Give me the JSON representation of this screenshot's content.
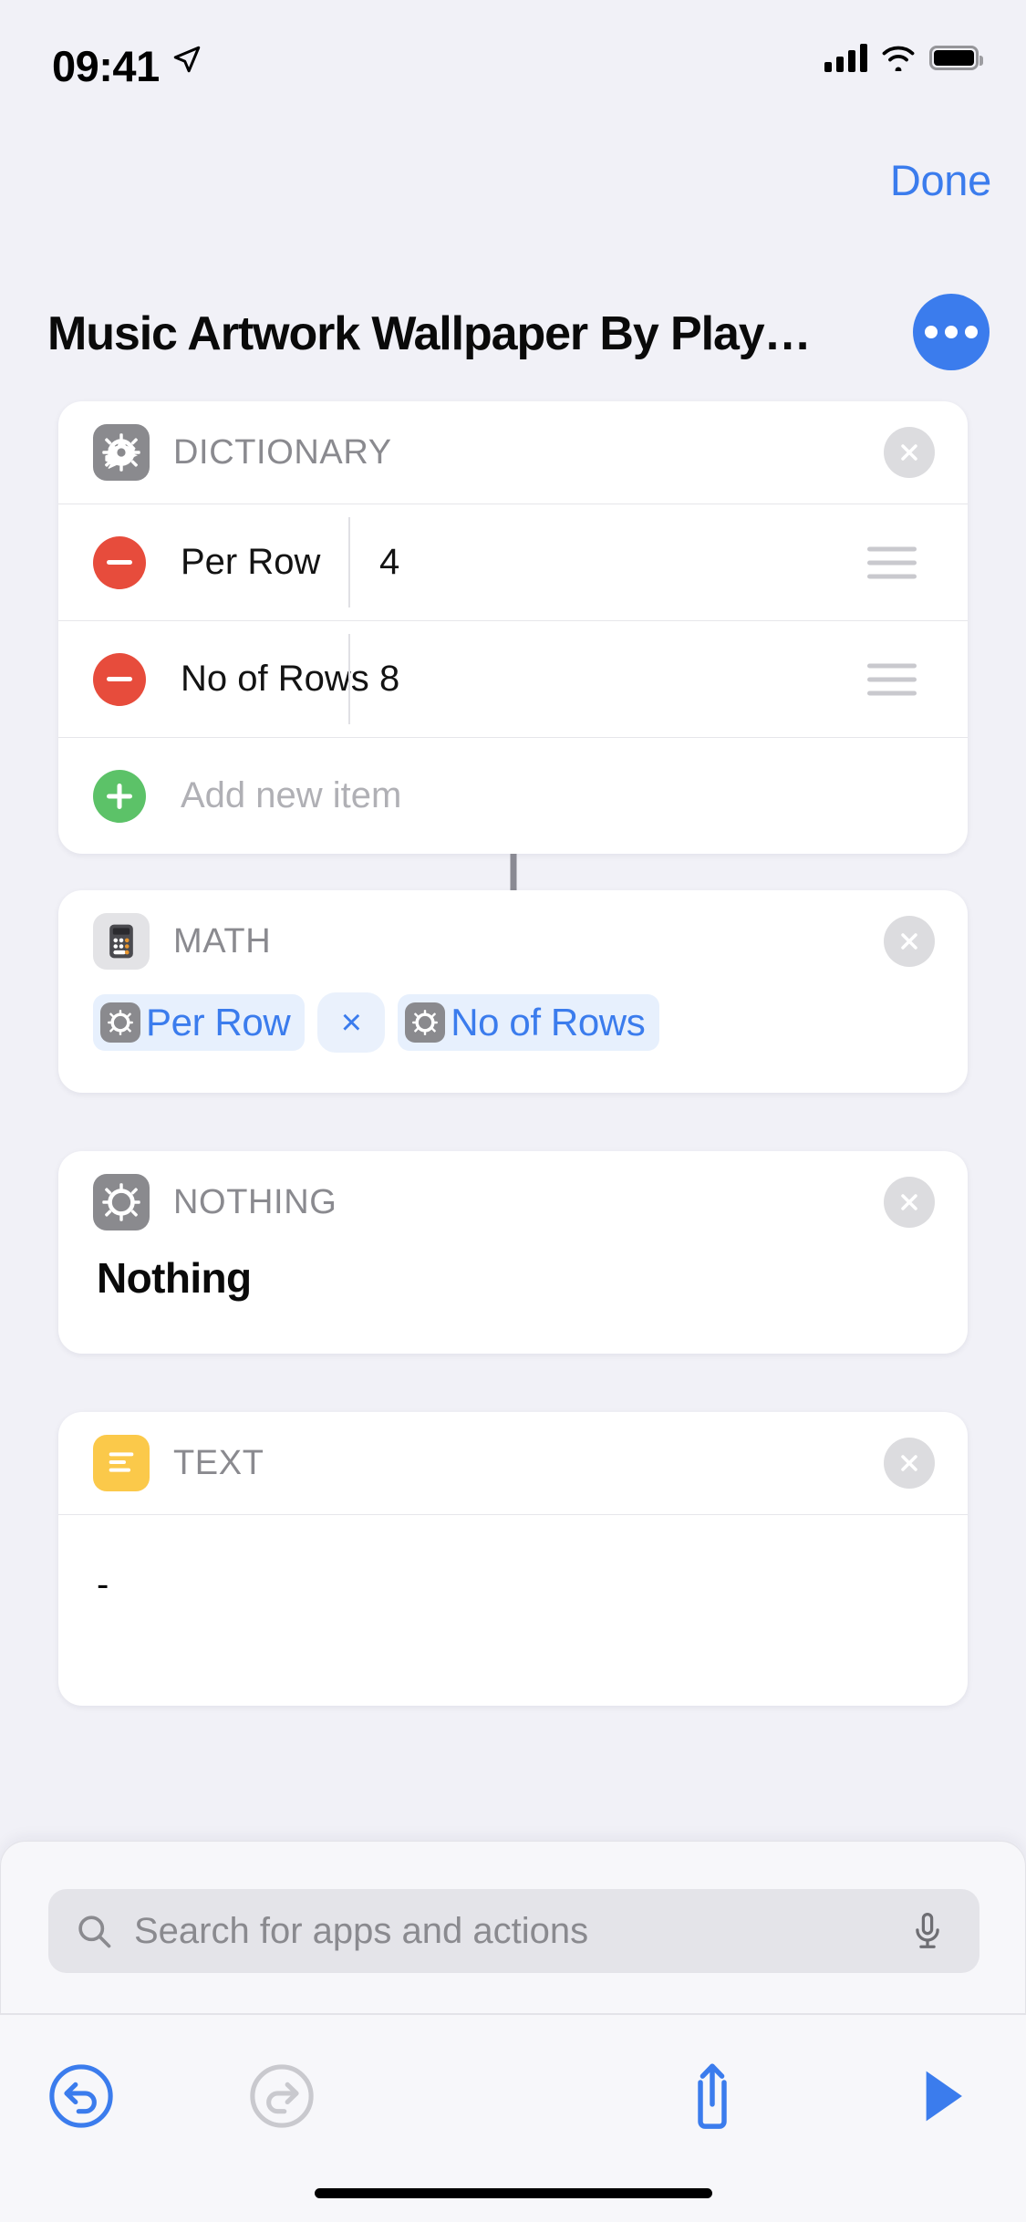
{
  "status_bar": {
    "time": "09:41",
    "location_icon": "location-arrow-icon",
    "cellular_icon": "cellular-bars-icon",
    "wifi_icon": "wifi-icon",
    "battery_icon": "battery-full-icon"
  },
  "nav": {
    "done_label": "Done",
    "accent_color": "#3b7ced"
  },
  "header": {
    "title": "Music Artwork Wallpaper By Play…",
    "more_button_icon": "ellipsis-icon",
    "more_button_color": "#3b7ced"
  },
  "actions": [
    {
      "kicker": "DICTIONARY",
      "icon": "gear-icon",
      "icon_color": "#8a8a8e",
      "close_icon": "close-circle-icon",
      "rows": [
        {
          "remove_icon": "minus-circle-icon",
          "key": "Per Row",
          "value": "4",
          "drag_icon": "drag-handle-icon"
        },
        {
          "remove_icon": "minus-circle-icon",
          "key": "No of Rows",
          "value": "8",
          "drag_icon": "drag-handle-icon"
        }
      ],
      "add_row": {
        "add_icon": "plus-circle-icon",
        "label": "Add new item"
      }
    },
    {
      "kicker": "MATH",
      "icon": "calculator-icon",
      "icon_color": "#e3e3e6",
      "close_icon": "close-circle-icon",
      "formula": {
        "left_token": {
          "icon": "gear-icon",
          "label": "Per Row"
        },
        "operator": "×",
        "right_token": {
          "icon": "gear-icon",
          "label": "No of Rows"
        }
      }
    },
    {
      "kicker": "NOTHING",
      "icon": "gear-icon",
      "icon_color": "#8a8a8e",
      "close_icon": "close-circle-icon",
      "body": "Nothing"
    },
    {
      "kicker": "TEXT",
      "icon": "text-lines-icon",
      "icon_color": "#fbc94a",
      "close_icon": "close-circle-icon",
      "body": "-"
    }
  ],
  "search": {
    "placeholder": "Search for apps and actions",
    "search_icon": "search-icon",
    "mic_icon": "microphone-icon"
  },
  "toolbar": {
    "undo_icon": "undo-icon",
    "redo_icon": "redo-icon",
    "share_icon": "share-icon",
    "play_icon": "play-icon",
    "undo_enabled_color": "#3b7ced",
    "redo_disabled_color": "#c9c9ce"
  }
}
